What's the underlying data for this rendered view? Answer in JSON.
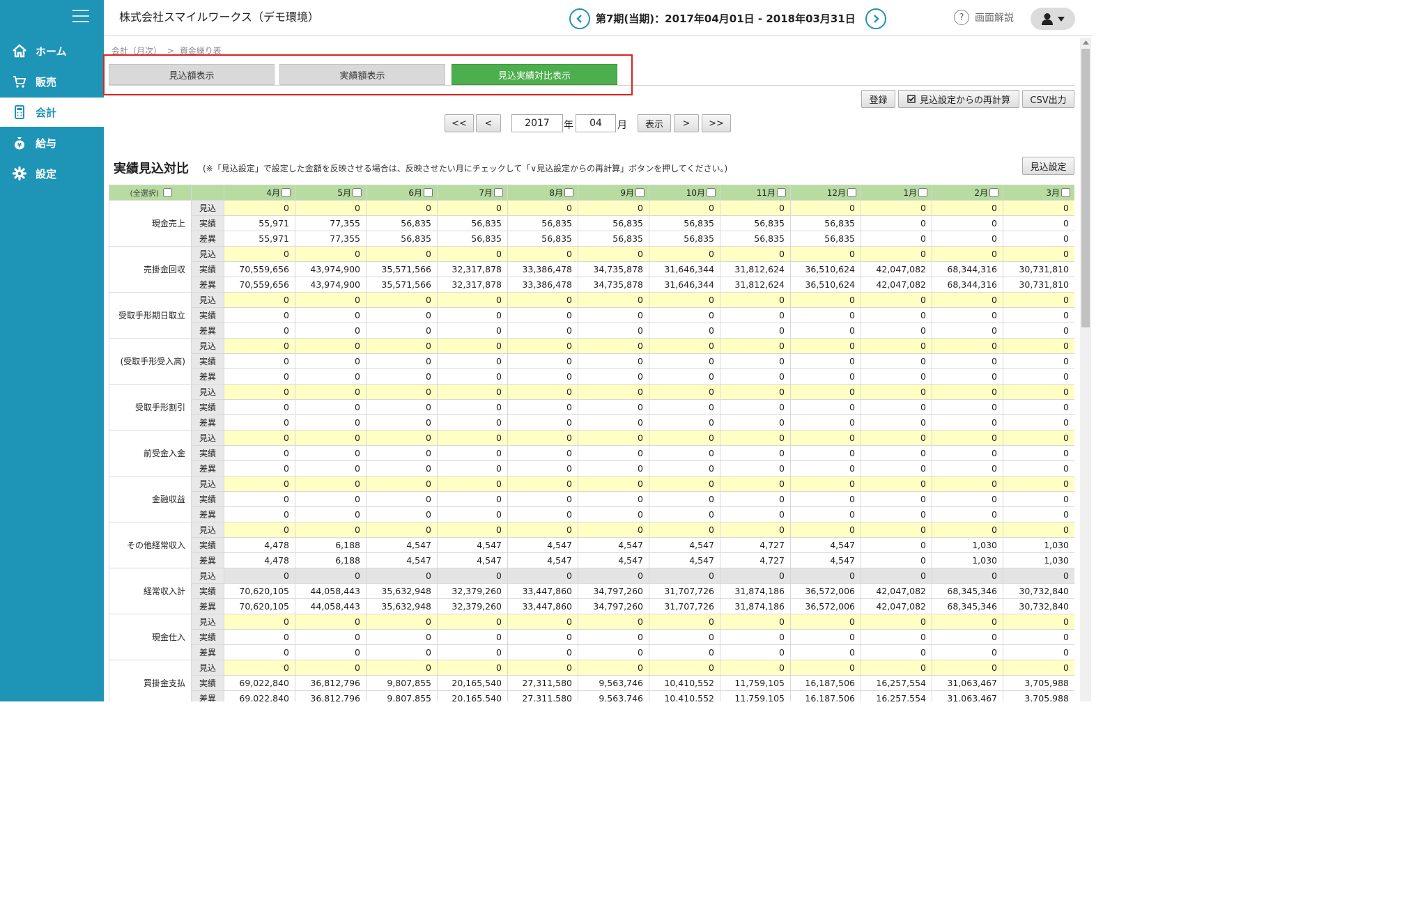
{
  "sidebar": {
    "items": [
      {
        "label": "ホーム",
        "icon": "home-icon"
      },
      {
        "label": "販売",
        "icon": "cart-icon"
      },
      {
        "label": "会計",
        "icon": "calculator-icon"
      },
      {
        "label": "給与",
        "icon": "money-bag-icon"
      },
      {
        "label": "設定",
        "icon": "gear-icon"
      }
    ],
    "active": "会計"
  },
  "header": {
    "company": "株式会社スマイルワークス（デモ環境）",
    "period": "第7期(当期)：2017年04月01日 - 2018年03月31日",
    "help_label": "画面解説"
  },
  "breadcrumb": {
    "parent": "会計（月次）",
    "separator": ">",
    "current": "資金繰り表"
  },
  "tabs": [
    {
      "label": "見込額表示",
      "active": false
    },
    {
      "label": "実績額表示",
      "active": false
    },
    {
      "label": "見込実績対比表示",
      "active": true
    }
  ],
  "actions": {
    "register": "登録",
    "recalc": "見込設定からの再計算",
    "csv": "CSV出力"
  },
  "nav": {
    "first": "<<",
    "prev": "<",
    "year": "2017",
    "year_unit": "年",
    "month": "04",
    "month_unit": "月",
    "show": "表示",
    "next": ">",
    "last": ">>"
  },
  "section": {
    "title": "実績見込対比",
    "note": "(※「見込設定」で設定した金額を反映させる場合は、反映させたい月にチェックして「∨見込設定からの再計算」ボタンを押してください。)",
    "settings_button": "見込設定"
  },
  "table": {
    "select_all": "(全選択)",
    "months": [
      "4月",
      "5月",
      "6月",
      "7月",
      "8月",
      "9月",
      "10月",
      "11月",
      "12月",
      "1月",
      "2月",
      "3月"
    ],
    "row_types": [
      "見込",
      "実績",
      "差異"
    ],
    "items": [
      {
        "name": "現金売上",
        "forecast": [
          "0",
          "0",
          "0",
          "0",
          "0",
          "0",
          "0",
          "0",
          "0",
          "0",
          "0",
          "0"
        ],
        "actual": [
          "55,971",
          "77,355",
          "56,835",
          "56,835",
          "56,835",
          "56,835",
          "56,835",
          "56,835",
          "56,835",
          "0",
          "0",
          "0"
        ],
        "diff": [
          "55,971",
          "77,355",
          "56,835",
          "56,835",
          "56,835",
          "56,835",
          "56,835",
          "56,835",
          "56,835",
          "0",
          "0",
          "0"
        ]
      },
      {
        "name": "売掛金回収",
        "forecast": [
          "0",
          "0",
          "0",
          "0",
          "0",
          "0",
          "0",
          "0",
          "0",
          "0",
          "0",
          "0"
        ],
        "actual": [
          "70,559,656",
          "43,974,900",
          "35,571,566",
          "32,317,878",
          "33,386,478",
          "34,735,878",
          "31,646,344",
          "31,812,624",
          "36,510,624",
          "42,047,082",
          "68,344,316",
          "30,731,810"
        ],
        "diff": [
          "70,559,656",
          "43,974,900",
          "35,571,566",
          "32,317,878",
          "33,386,478",
          "34,735,878",
          "31,646,344",
          "31,812,624",
          "36,510,624",
          "42,047,082",
          "68,344,316",
          "30,731,810"
        ]
      },
      {
        "name": "受取手形期日取立",
        "forecast": [
          "0",
          "0",
          "0",
          "0",
          "0",
          "0",
          "0",
          "0",
          "0",
          "0",
          "0",
          "0"
        ],
        "actual": [
          "0",
          "0",
          "0",
          "0",
          "0",
          "0",
          "0",
          "0",
          "0",
          "0",
          "0",
          "0"
        ],
        "diff": [
          "0",
          "0",
          "0",
          "0",
          "0",
          "0",
          "0",
          "0",
          "0",
          "0",
          "0",
          "0"
        ]
      },
      {
        "name": "(受取手形受入高)",
        "forecast": [
          "0",
          "0",
          "0",
          "0",
          "0",
          "0",
          "0",
          "0",
          "0",
          "0",
          "0",
          "0"
        ],
        "actual": [
          "0",
          "0",
          "0",
          "0",
          "0",
          "0",
          "0",
          "0",
          "0",
          "0",
          "0",
          "0"
        ],
        "diff": [
          "0",
          "0",
          "0",
          "0",
          "0",
          "0",
          "0",
          "0",
          "0",
          "0",
          "0",
          "0"
        ]
      },
      {
        "name": "受取手形割引",
        "forecast": [
          "0",
          "0",
          "0",
          "0",
          "0",
          "0",
          "0",
          "0",
          "0",
          "0",
          "0",
          "0"
        ],
        "actual": [
          "0",
          "0",
          "0",
          "0",
          "0",
          "0",
          "0",
          "0",
          "0",
          "0",
          "0",
          "0"
        ],
        "diff": [
          "0",
          "0",
          "0",
          "0",
          "0",
          "0",
          "0",
          "0",
          "0",
          "0",
          "0",
          "0"
        ]
      },
      {
        "name": "前受金入金",
        "forecast": [
          "0",
          "0",
          "0",
          "0",
          "0",
          "0",
          "0",
          "0",
          "0",
          "0",
          "0",
          "0"
        ],
        "actual": [
          "0",
          "0",
          "0",
          "0",
          "0",
          "0",
          "0",
          "0",
          "0",
          "0",
          "0",
          "0"
        ],
        "diff": [
          "0",
          "0",
          "0",
          "0",
          "0",
          "0",
          "0",
          "0",
          "0",
          "0",
          "0",
          "0"
        ]
      },
      {
        "name": "金融収益",
        "forecast": [
          "0",
          "0",
          "0",
          "0",
          "0",
          "0",
          "0",
          "0",
          "0",
          "0",
          "0",
          "0"
        ],
        "actual": [
          "0",
          "0",
          "0",
          "0",
          "0",
          "0",
          "0",
          "0",
          "0",
          "0",
          "0",
          "0"
        ],
        "diff": [
          "0",
          "0",
          "0",
          "0",
          "0",
          "0",
          "0",
          "0",
          "0",
          "0",
          "0",
          "0"
        ]
      },
      {
        "name": "その他経常収入",
        "forecast": [
          "0",
          "0",
          "0",
          "0",
          "0",
          "0",
          "0",
          "0",
          "0",
          "0",
          "0",
          "0"
        ],
        "actual": [
          "4,478",
          "6,188",
          "4,547",
          "4,547",
          "4,547",
          "4,547",
          "4,547",
          "4,727",
          "4,547",
          "0",
          "1,030",
          "1,030"
        ],
        "diff": [
          "4,478",
          "6,188",
          "4,547",
          "4,547",
          "4,547",
          "4,547",
          "4,547",
          "4,727",
          "4,547",
          "0",
          "1,030",
          "1,030"
        ]
      },
      {
        "name": "経常収入計",
        "total": true,
        "forecast": [
          "0",
          "0",
          "0",
          "0",
          "0",
          "0",
          "0",
          "0",
          "0",
          "0",
          "0",
          "0"
        ],
        "actual": [
          "70,620,105",
          "44,058,443",
          "35,632,948",
          "32,379,260",
          "33,447,860",
          "34,797,260",
          "31,707,726",
          "31,874,186",
          "36,572,006",
          "42,047,082",
          "68,345,346",
          "30,732,840"
        ],
        "diff": [
          "70,620,105",
          "44,058,443",
          "35,632,948",
          "32,379,260",
          "33,447,860",
          "34,797,260",
          "31,707,726",
          "31,874,186",
          "36,572,006",
          "42,047,082",
          "68,345,346",
          "30,732,840"
        ]
      },
      {
        "name": "現金仕入",
        "forecast": [
          "0",
          "0",
          "0",
          "0",
          "0",
          "0",
          "0",
          "0",
          "0",
          "0",
          "0",
          "0"
        ],
        "actual": [
          "0",
          "0",
          "0",
          "0",
          "0",
          "0",
          "0",
          "0",
          "0",
          "0",
          "0",
          "0"
        ],
        "diff": [
          "0",
          "0",
          "0",
          "0",
          "0",
          "0",
          "0",
          "0",
          "0",
          "0",
          "0",
          "0"
        ]
      },
      {
        "name": "買掛金支払",
        "forecast": [
          "0",
          "0",
          "0",
          "0",
          "0",
          "0",
          "0",
          "0",
          "0",
          "0",
          "0",
          "0"
        ],
        "actual": [
          "69,022,840",
          "36,812,796",
          "9,807,855",
          "20,165,540",
          "27,311,580",
          "9,563,746",
          "10,410,552",
          "11,759,105",
          "16,187,506",
          "16,257,554",
          "31,063,467",
          "3,705,988"
        ],
        "diff": [
          "69,022,840",
          "36,812,796",
          "9,807,855",
          "20,165,540",
          "27,311,580",
          "9,563,746",
          "10,410,552",
          "11,759,105",
          "16,187,506",
          "16,257,554",
          "31,063,467",
          "3,705,988"
        ]
      }
    ]
  }
}
